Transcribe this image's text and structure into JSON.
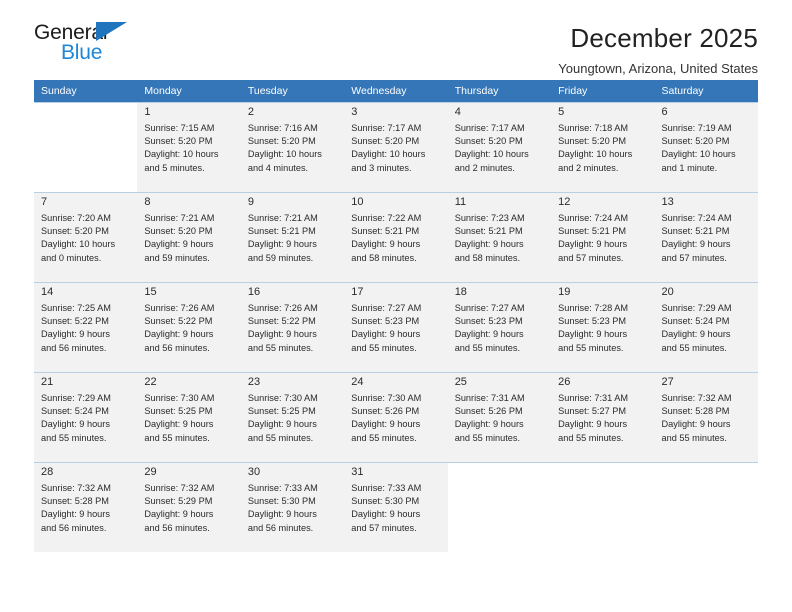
{
  "brand": {
    "name_top": "General",
    "name_bottom": "Blue",
    "accent_color": "#1f87d8",
    "triangle_color": "#1f74bd"
  },
  "header": {
    "title": "December 2025",
    "subtitle": "Youngtown, Arizona, United States"
  },
  "theme": {
    "header_row_bg": "#3576b8",
    "header_row_text": "#ffffff",
    "cell_shaded_bg": "#f2f2f2",
    "cell_border": "#b9cfe4"
  },
  "weekday_headers": [
    "Sunday",
    "Monday",
    "Tuesday",
    "Wednesday",
    "Thursday",
    "Friday",
    "Saturday"
  ],
  "weeks": [
    [
      {
        "day": "",
        "sunrise": "",
        "sunset": "",
        "daylight_line1": "",
        "daylight_line2": ""
      },
      {
        "day": "1",
        "sunrise": "Sunrise: 7:15 AM",
        "sunset": "Sunset: 5:20 PM",
        "daylight_line1": "Daylight: 10 hours",
        "daylight_line2": "and 5 minutes."
      },
      {
        "day": "2",
        "sunrise": "Sunrise: 7:16 AM",
        "sunset": "Sunset: 5:20 PM",
        "daylight_line1": "Daylight: 10 hours",
        "daylight_line2": "and 4 minutes."
      },
      {
        "day": "3",
        "sunrise": "Sunrise: 7:17 AM",
        "sunset": "Sunset: 5:20 PM",
        "daylight_line1": "Daylight: 10 hours",
        "daylight_line2": "and 3 minutes."
      },
      {
        "day": "4",
        "sunrise": "Sunrise: 7:17 AM",
        "sunset": "Sunset: 5:20 PM",
        "daylight_line1": "Daylight: 10 hours",
        "daylight_line2": "and 2 minutes."
      },
      {
        "day": "5",
        "sunrise": "Sunrise: 7:18 AM",
        "sunset": "Sunset: 5:20 PM",
        "daylight_line1": "Daylight: 10 hours",
        "daylight_line2": "and 2 minutes."
      },
      {
        "day": "6",
        "sunrise": "Sunrise: 7:19 AM",
        "sunset": "Sunset: 5:20 PM",
        "daylight_line1": "Daylight: 10 hours",
        "daylight_line2": "and 1 minute."
      }
    ],
    [
      {
        "day": "7",
        "sunrise": "Sunrise: 7:20 AM",
        "sunset": "Sunset: 5:20 PM",
        "daylight_line1": "Daylight: 10 hours",
        "daylight_line2": "and 0 minutes."
      },
      {
        "day": "8",
        "sunrise": "Sunrise: 7:21 AM",
        "sunset": "Sunset: 5:20 PM",
        "daylight_line1": "Daylight: 9 hours",
        "daylight_line2": "and 59 minutes."
      },
      {
        "day": "9",
        "sunrise": "Sunrise: 7:21 AM",
        "sunset": "Sunset: 5:21 PM",
        "daylight_line1": "Daylight: 9 hours",
        "daylight_line2": "and 59 minutes."
      },
      {
        "day": "10",
        "sunrise": "Sunrise: 7:22 AM",
        "sunset": "Sunset: 5:21 PM",
        "daylight_line1": "Daylight: 9 hours",
        "daylight_line2": "and 58 minutes."
      },
      {
        "day": "11",
        "sunrise": "Sunrise: 7:23 AM",
        "sunset": "Sunset: 5:21 PM",
        "daylight_line1": "Daylight: 9 hours",
        "daylight_line2": "and 58 minutes."
      },
      {
        "day": "12",
        "sunrise": "Sunrise: 7:24 AM",
        "sunset": "Sunset: 5:21 PM",
        "daylight_line1": "Daylight: 9 hours",
        "daylight_line2": "and 57 minutes."
      },
      {
        "day": "13",
        "sunrise": "Sunrise: 7:24 AM",
        "sunset": "Sunset: 5:21 PM",
        "daylight_line1": "Daylight: 9 hours",
        "daylight_line2": "and 57 minutes."
      }
    ],
    [
      {
        "day": "14",
        "sunrise": "Sunrise: 7:25 AM",
        "sunset": "Sunset: 5:22 PM",
        "daylight_line1": "Daylight: 9 hours",
        "daylight_line2": "and 56 minutes."
      },
      {
        "day": "15",
        "sunrise": "Sunrise: 7:26 AM",
        "sunset": "Sunset: 5:22 PM",
        "daylight_line1": "Daylight: 9 hours",
        "daylight_line2": "and 56 minutes."
      },
      {
        "day": "16",
        "sunrise": "Sunrise: 7:26 AM",
        "sunset": "Sunset: 5:22 PM",
        "daylight_line1": "Daylight: 9 hours",
        "daylight_line2": "and 55 minutes."
      },
      {
        "day": "17",
        "sunrise": "Sunrise: 7:27 AM",
        "sunset": "Sunset: 5:23 PM",
        "daylight_line1": "Daylight: 9 hours",
        "daylight_line2": "and 55 minutes."
      },
      {
        "day": "18",
        "sunrise": "Sunrise: 7:27 AM",
        "sunset": "Sunset: 5:23 PM",
        "daylight_line1": "Daylight: 9 hours",
        "daylight_line2": "and 55 minutes."
      },
      {
        "day": "19",
        "sunrise": "Sunrise: 7:28 AM",
        "sunset": "Sunset: 5:23 PM",
        "daylight_line1": "Daylight: 9 hours",
        "daylight_line2": "and 55 minutes."
      },
      {
        "day": "20",
        "sunrise": "Sunrise: 7:29 AM",
        "sunset": "Sunset: 5:24 PM",
        "daylight_line1": "Daylight: 9 hours",
        "daylight_line2": "and 55 minutes."
      }
    ],
    [
      {
        "day": "21",
        "sunrise": "Sunrise: 7:29 AM",
        "sunset": "Sunset: 5:24 PM",
        "daylight_line1": "Daylight: 9 hours",
        "daylight_line2": "and 55 minutes."
      },
      {
        "day": "22",
        "sunrise": "Sunrise: 7:30 AM",
        "sunset": "Sunset: 5:25 PM",
        "daylight_line1": "Daylight: 9 hours",
        "daylight_line2": "and 55 minutes."
      },
      {
        "day": "23",
        "sunrise": "Sunrise: 7:30 AM",
        "sunset": "Sunset: 5:25 PM",
        "daylight_line1": "Daylight: 9 hours",
        "daylight_line2": "and 55 minutes."
      },
      {
        "day": "24",
        "sunrise": "Sunrise: 7:30 AM",
        "sunset": "Sunset: 5:26 PM",
        "daylight_line1": "Daylight: 9 hours",
        "daylight_line2": "and 55 minutes."
      },
      {
        "day": "25",
        "sunrise": "Sunrise: 7:31 AM",
        "sunset": "Sunset: 5:26 PM",
        "daylight_line1": "Daylight: 9 hours",
        "daylight_line2": "and 55 minutes."
      },
      {
        "day": "26",
        "sunrise": "Sunrise: 7:31 AM",
        "sunset": "Sunset: 5:27 PM",
        "daylight_line1": "Daylight: 9 hours",
        "daylight_line2": "and 55 minutes."
      },
      {
        "day": "27",
        "sunrise": "Sunrise: 7:32 AM",
        "sunset": "Sunset: 5:28 PM",
        "daylight_line1": "Daylight: 9 hours",
        "daylight_line2": "and 55 minutes."
      }
    ],
    [
      {
        "day": "28",
        "sunrise": "Sunrise: 7:32 AM",
        "sunset": "Sunset: 5:28 PM",
        "daylight_line1": "Daylight: 9 hours",
        "daylight_line2": "and 56 minutes."
      },
      {
        "day": "29",
        "sunrise": "Sunrise: 7:32 AM",
        "sunset": "Sunset: 5:29 PM",
        "daylight_line1": "Daylight: 9 hours",
        "daylight_line2": "and 56 minutes."
      },
      {
        "day": "30",
        "sunrise": "Sunrise: 7:33 AM",
        "sunset": "Sunset: 5:30 PM",
        "daylight_line1": "Daylight: 9 hours",
        "daylight_line2": "and 56 minutes."
      },
      {
        "day": "31",
        "sunrise": "Sunrise: 7:33 AM",
        "sunset": "Sunset: 5:30 PM",
        "daylight_line1": "Daylight: 9 hours",
        "daylight_line2": "and 57 minutes."
      },
      {
        "day": "",
        "sunrise": "",
        "sunset": "",
        "daylight_line1": "",
        "daylight_line2": ""
      },
      {
        "day": "",
        "sunrise": "",
        "sunset": "",
        "daylight_line1": "",
        "daylight_line2": ""
      },
      {
        "day": "",
        "sunrise": "",
        "sunset": "",
        "daylight_line1": "",
        "daylight_line2": ""
      }
    ]
  ]
}
